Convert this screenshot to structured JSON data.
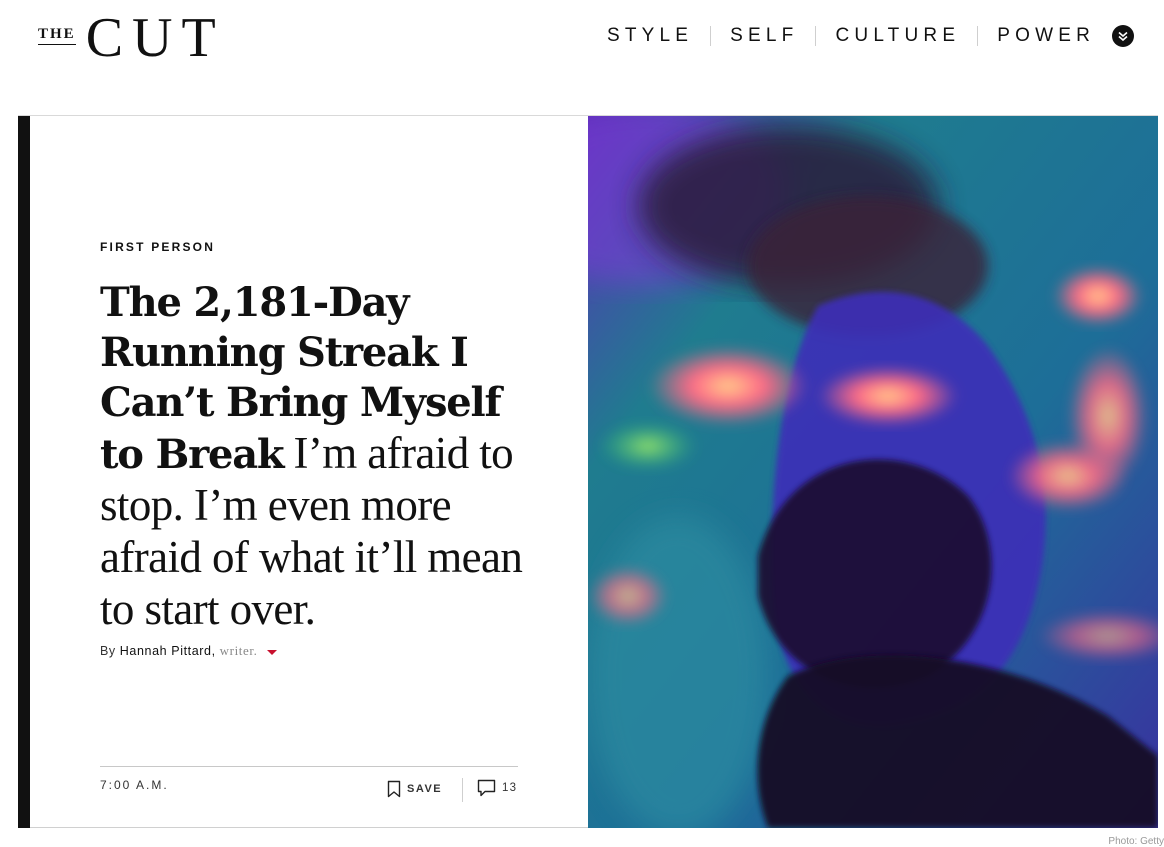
{
  "header": {
    "logo_the": "THE",
    "logo_cut": "CUT",
    "nav": [
      {
        "label": "STYLE"
      },
      {
        "label": "SELF"
      },
      {
        "label": "CULTURE"
      },
      {
        "label": "POWER"
      }
    ],
    "menu_icon": "chevron-down-double-icon"
  },
  "article": {
    "rubric": "FIRST PERSON",
    "headline": "The 2,181-Day Running Streak I Can’t Bring Myself to Break",
    "dek": "I’m afraid to stop. I’m even more afraid of what it’ll mean to start over.",
    "byline_prefix": "By",
    "author": "Hannah Pittard,",
    "author_role": "writer.",
    "timestamp": "7:00 A.M.",
    "save_label": "SAVE",
    "comment_count": "13",
    "photo_credit": "Photo: Getty"
  },
  "icons": {
    "save": "bookmark-icon",
    "comments": "comment-bubble-icon",
    "byline_toggle": "caret-down-icon"
  },
  "colors": {
    "accent": "#c8102e",
    "text": "#111111",
    "left_bar": "#111111"
  }
}
